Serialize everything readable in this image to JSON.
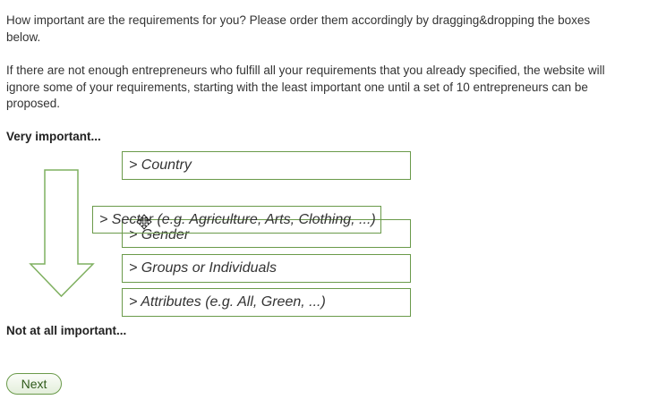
{
  "instructions": {
    "paragraph1": "How important are the requirements for you? Please order them accordingly by dragging&dropping the boxes below.",
    "paragraph2": "If there are not enough entrepreneurs who fulfill all your requirements that you already specified, the website will ignore some of your requirements, starting with the least important one until a set of 10 entrepreneurs can be proposed."
  },
  "scale": {
    "top_label": "Very important...",
    "bottom_label": "Not at all important..."
  },
  "requirements": {
    "country": "> Country",
    "sector_dragging": "> Sector (e.g. Agriculture, Arts, Clothing, ...)",
    "gender": "> Gender",
    "groups": "> Groups or Individuals",
    "attributes": "> Attributes (e.g. All, Green, ...)"
  },
  "actions": {
    "next_label": "Next"
  },
  "colors": {
    "box_border": "#6a9a4a",
    "arrow_stroke": "#7fb060"
  }
}
